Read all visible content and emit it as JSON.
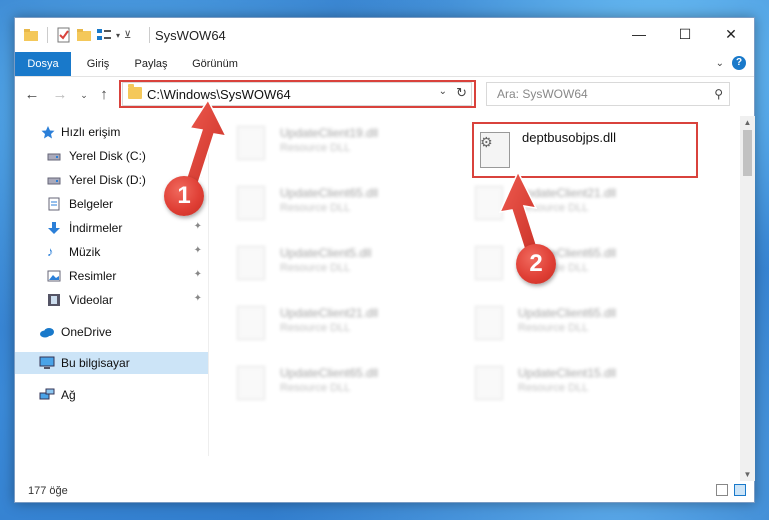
{
  "window": {
    "title": "SysWOW64",
    "controls": {
      "minimize": "—",
      "maximize": "☐",
      "close": "✕"
    }
  },
  "ribbon": {
    "tabs": [
      "Dosya",
      "Giriş",
      "Paylaş",
      "Görünüm"
    ],
    "help": "?"
  },
  "address": {
    "path": "C:\\Windows\\SysWOW64"
  },
  "search": {
    "placeholder": "Ara: SysWOW64"
  },
  "nav": {
    "items": [
      {
        "label": "Hızlı erişim",
        "icon": "star-icon"
      },
      {
        "label": "Yerel Disk (C:)",
        "icon": "drive-icon",
        "pinned": true
      },
      {
        "label": "Yerel Disk (D:)",
        "icon": "drive-icon",
        "pinned": true
      },
      {
        "label": "Belgeler",
        "icon": "documents-icon",
        "pinned": true
      },
      {
        "label": "İndirmeler",
        "icon": "download-icon",
        "pinned": true
      },
      {
        "label": "Müzik",
        "icon": "music-icon",
        "pinned": true
      },
      {
        "label": "Resimler",
        "icon": "pictures-icon",
        "pinned": true
      },
      {
        "label": "Videolar",
        "icon": "videos-icon",
        "pinned": true
      },
      {
        "label": "OneDrive",
        "icon": "cloud-icon"
      },
      {
        "label": "Bu bilgisayar",
        "icon": "computer-icon",
        "selected": true
      },
      {
        "label": "Ağ",
        "icon": "network-icon"
      }
    ]
  },
  "files": {
    "left_column": [
      {
        "name": "UpdateClient19.dll",
        "type": "Resource DLL"
      },
      {
        "name": "UpdateClient65.dll",
        "type": "Resource DLL"
      },
      {
        "name": "UpdateClient5.dll",
        "type": "Resource DLL"
      },
      {
        "name": "UpdateClient21.dll",
        "type": "Resource DLL"
      },
      {
        "name": "UpdateClient65.dll",
        "type": "Resource DLL"
      }
    ],
    "right_column": [
      {
        "name": "UpdateClient21.dll",
        "type": "Resource DLL"
      },
      {
        "name": "UpdateClient65.dll",
        "type": "Resource DLL"
      },
      {
        "name": "UpdateClient65.dll",
        "type": "Resource DLL"
      },
      {
        "name": "UpdateClient15.dll",
        "type": "Resource DLL"
      }
    ],
    "highlighted": {
      "name": "deptbusobjps.dll"
    }
  },
  "status": {
    "count": "177 öğe"
  },
  "annotations": {
    "step1": "1",
    "step2": "2",
    "color": "#d9423c"
  }
}
